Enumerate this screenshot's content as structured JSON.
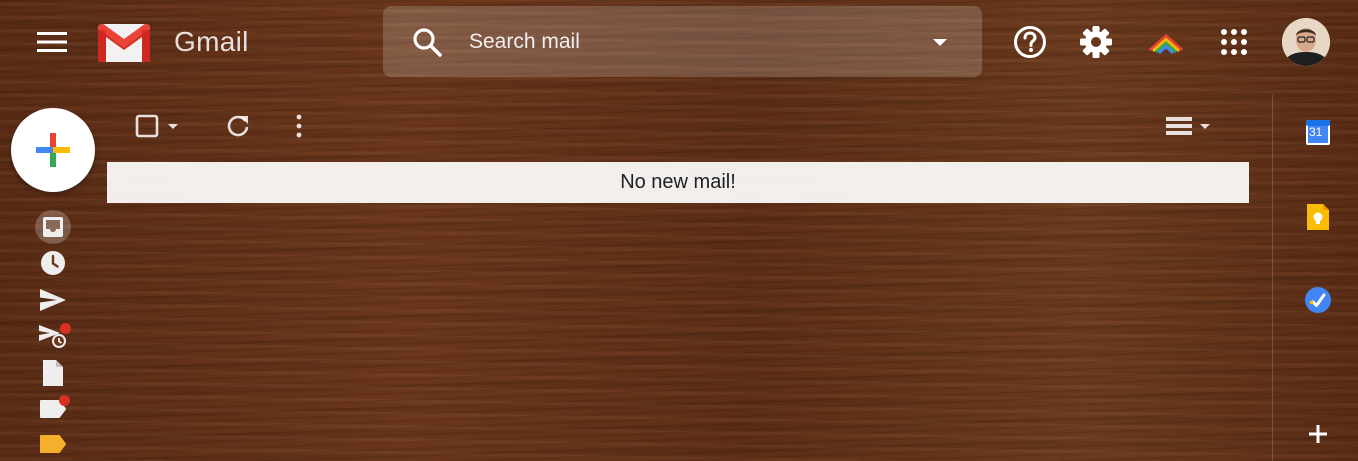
{
  "header": {
    "app_name": "Gmail",
    "search": {
      "placeholder": "Search mail",
      "value": ""
    },
    "icons": [
      "main-menu-icon",
      "gmail-logo",
      "search-icon",
      "search-options-icon",
      "help-icon",
      "settings-icon",
      "rainbow-app-icon",
      "apps-grid-icon",
      "avatar"
    ]
  },
  "compose": {
    "icon": "compose-plus-icon"
  },
  "nav": {
    "items": [
      {
        "name": "inbox",
        "icon": "inbox-icon",
        "active": true
      },
      {
        "name": "snoozed",
        "icon": "clock-icon"
      },
      {
        "name": "sent",
        "icon": "send-icon"
      },
      {
        "name": "scheduled",
        "icon": "scheduled-send-icon",
        "badge": true
      },
      {
        "name": "drafts",
        "icon": "draft-icon"
      },
      {
        "name": "label",
        "icon": "label-icon",
        "badge": true
      },
      {
        "name": "important",
        "icon": "important-label-icon",
        "color": "#f6ae2d"
      }
    ]
  },
  "toolbar": {
    "icons": [
      "select-checkbox",
      "select-dropdown-icon",
      "refresh-icon",
      "more-options-icon",
      "density-icon",
      "density-dropdown-icon"
    ]
  },
  "main": {
    "empty_message": "No new mail!"
  },
  "side_panel": {
    "apps": [
      {
        "name": "calendar",
        "label": "31",
        "color": "#1a73e8"
      },
      {
        "name": "keep",
        "color": "#fbbc04"
      },
      {
        "name": "tasks",
        "color": "#4285f4"
      },
      {
        "name": "add-addon",
        "icon": "plus-icon"
      }
    ]
  },
  "colors": {
    "google_blue": "#4285f4",
    "google_red": "#ea4335",
    "google_yellow": "#fbbc04",
    "google_green": "#34a853",
    "badge_red": "#d93025"
  }
}
